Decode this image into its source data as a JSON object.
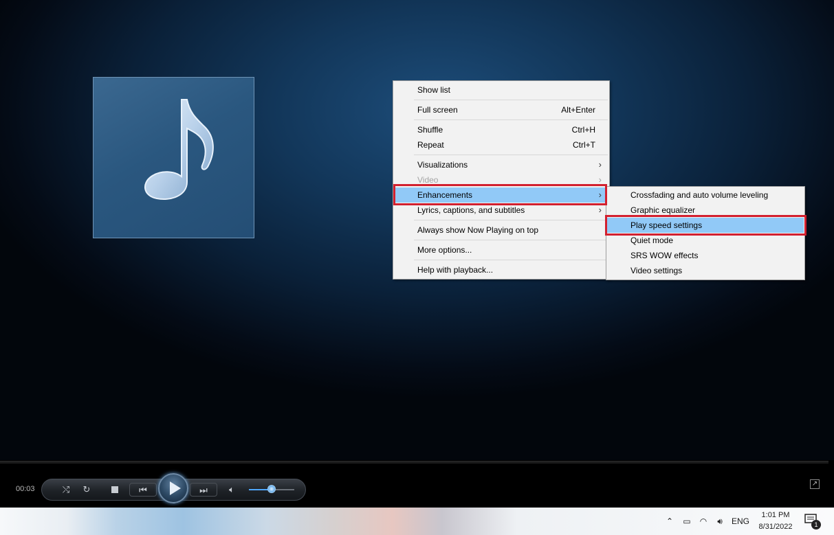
{
  "menu": {
    "items": [
      {
        "label": "Show list",
        "shortcut": ""
      },
      {
        "label": "Full screen",
        "shortcut": "Alt+Enter"
      },
      {
        "label": "Shuffle",
        "shortcut": "Ctrl+H"
      },
      {
        "label": "Repeat",
        "shortcut": "Ctrl+T"
      },
      {
        "label": "Visualizations",
        "submenu": true
      },
      {
        "label": "Video",
        "submenu": true,
        "disabled": true
      },
      {
        "label": "Enhancements",
        "submenu": true,
        "highlighted": true
      },
      {
        "label": "Lyrics, captions, and subtitles",
        "submenu": true
      },
      {
        "label": "Always show Now Playing on top"
      },
      {
        "label": "More options..."
      },
      {
        "label": "Help with playback..."
      }
    ],
    "arrow_glyph": "›"
  },
  "submenu": {
    "items": [
      {
        "label": "Crossfading and auto volume leveling"
      },
      {
        "label": "Graphic equalizer"
      },
      {
        "label": "Play speed settings",
        "highlighted": true
      },
      {
        "label": "Quiet mode"
      },
      {
        "label": "SRS WOW effects"
      },
      {
        "label": "Video settings"
      }
    ]
  },
  "player": {
    "elapsed_time": "00:03",
    "volume_level": 0.5,
    "album_art_icon": "music-note-icon"
  },
  "taskbar": {
    "language": "ENG",
    "time": "1:01 PM",
    "date": "8/31/2022",
    "notification_count": "1"
  },
  "colors": {
    "highlight": "#91c9f7",
    "annotation_box": "#d2202f",
    "menu_bg": "#f2f2f2"
  }
}
